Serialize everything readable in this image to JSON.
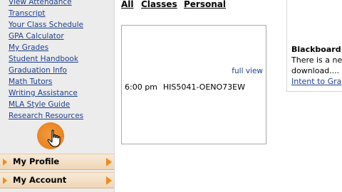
{
  "sidebar": {
    "links": [
      "View Attendance",
      "Transcript",
      "Your Class Schedule",
      "GPA Calculator",
      "My Grades",
      "Student Handbook",
      "Graduation Info",
      "Math Tutors",
      "Writing Assistance",
      "MLA Style Guide",
      "Research Resources"
    ],
    "menu": {
      "profile": "My Profile",
      "account": "My Account"
    }
  },
  "main": {
    "tabs": [
      "All",
      "Classes",
      "Personal"
    ],
    "calendar": {
      "full_view": "full view",
      "event_time": "6:00 pm",
      "event_code": "HIS5041-OENO73EW"
    }
  },
  "right": {
    "title": "Blackboard",
    "line1": "There is a ne",
    "line2": "download....",
    "link": "Intent to Gra"
  },
  "colors": {
    "link": "#1d3f8f",
    "accent_orange": "#f08a1c",
    "sidebar_bg": "#ececec"
  }
}
